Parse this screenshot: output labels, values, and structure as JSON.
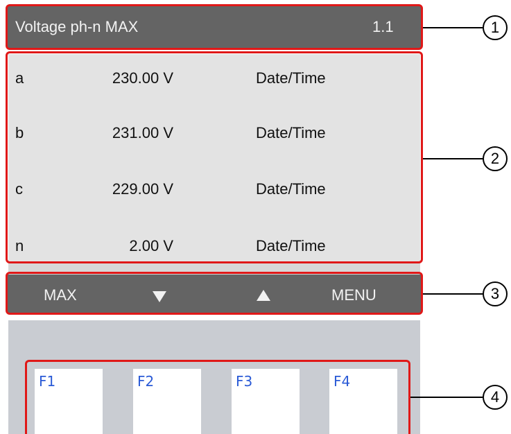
{
  "title_bar": {
    "title": "Voltage ph-n MAX",
    "page_number": "1.1"
  },
  "readings": [
    {
      "phase": "a",
      "value": "230.00 V",
      "timestamp": "Date/Time"
    },
    {
      "phase": "b",
      "value": "231.00 V",
      "timestamp": "Date/Time"
    },
    {
      "phase": "c",
      "value": "229.00 V",
      "timestamp": "Date/Time"
    },
    {
      "phase": "n",
      "value": "2.00 V",
      "timestamp": "Date/Time"
    }
  ],
  "softkey_bar": {
    "left_label": "MAX",
    "down_icon": "triangle-down-icon",
    "up_icon": "triangle-up-icon",
    "right_label": "MENU"
  },
  "function_keys": [
    {
      "label": "F1"
    },
    {
      "label": "F2"
    },
    {
      "label": "F3"
    },
    {
      "label": "F4"
    }
  ],
  "callouts": [
    "1",
    "2",
    "3",
    "4"
  ],
  "colors": {
    "bar_background": "#646464",
    "panel_background": "#e3e3e3",
    "highlight_frame": "#e01818",
    "function_key_text": "#2a5ad6"
  }
}
